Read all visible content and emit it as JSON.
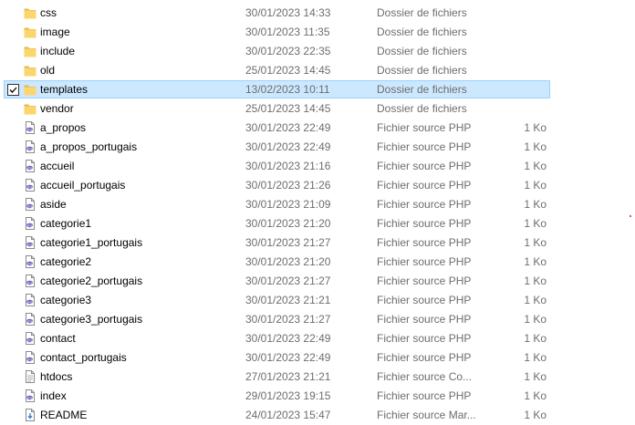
{
  "files": [
    {
      "name": "css",
      "date": "30/01/2023 14:33",
      "type": "Dossier de fichiers",
      "size": "",
      "icon": "folder-icon"
    },
    {
      "name": "image",
      "date": "30/01/2023 11:35",
      "type": "Dossier de fichiers",
      "size": "",
      "icon": "folder-icon"
    },
    {
      "name": "include",
      "date": "30/01/2023 22:35",
      "type": "Dossier de fichiers",
      "size": "",
      "icon": "folder-icon"
    },
    {
      "name": "old",
      "date": "25/01/2023 14:45",
      "type": "Dossier de fichiers",
      "size": "",
      "icon": "folder-icon"
    },
    {
      "name": "templates",
      "date": "13/02/2023 10:11",
      "type": "Dossier de fichiers",
      "size": "",
      "icon": "folder-icon",
      "selected": true,
      "checked": true
    },
    {
      "name": "vendor",
      "date": "25/01/2023 14:45",
      "type": "Dossier de fichiers",
      "size": "",
      "icon": "folder-icon"
    },
    {
      "name": "a_propos",
      "date": "30/01/2023 22:49",
      "type": "Fichier source PHP",
      "size": "1 Ko",
      "icon": "php-file-icon"
    },
    {
      "name": "a_propos_portugais",
      "date": "30/01/2023 22:49",
      "type": "Fichier source PHP",
      "size": "1 Ko",
      "icon": "php-file-icon"
    },
    {
      "name": "accueil",
      "date": "30/01/2023 21:16",
      "type": "Fichier source PHP",
      "size": "1 Ko",
      "icon": "php-file-icon"
    },
    {
      "name": "accueil_portugais",
      "date": "30/01/2023 21:26",
      "type": "Fichier source PHP",
      "size": "1 Ko",
      "icon": "php-file-icon"
    },
    {
      "name": "aside",
      "date": "30/01/2023 21:09",
      "type": "Fichier source PHP",
      "size": "1 Ko",
      "icon": "php-file-icon"
    },
    {
      "name": "categorie1",
      "date": "30/01/2023 21:20",
      "type": "Fichier source PHP",
      "size": "1 Ko",
      "icon": "php-file-icon"
    },
    {
      "name": "categorie1_portugais",
      "date": "30/01/2023 21:27",
      "type": "Fichier source PHP",
      "size": "1 Ko",
      "icon": "php-file-icon"
    },
    {
      "name": "categorie2",
      "date": "30/01/2023 21:20",
      "type": "Fichier source PHP",
      "size": "1 Ko",
      "icon": "php-file-icon"
    },
    {
      "name": "categorie2_portugais",
      "date": "30/01/2023 21:27",
      "type": "Fichier source PHP",
      "size": "1 Ko",
      "icon": "php-file-icon"
    },
    {
      "name": "categorie3",
      "date": "30/01/2023 21:21",
      "type": "Fichier source PHP",
      "size": "1 Ko",
      "icon": "php-file-icon"
    },
    {
      "name": "categorie3_portugais",
      "date": "30/01/2023 21:27",
      "type": "Fichier source PHP",
      "size": "1 Ko",
      "icon": "php-file-icon"
    },
    {
      "name": "contact",
      "date": "30/01/2023 22:49",
      "type": "Fichier source PHP",
      "size": "1 Ko",
      "icon": "php-file-icon"
    },
    {
      "name": "contact_portugais",
      "date": "30/01/2023 22:49",
      "type": "Fichier source PHP",
      "size": "1 Ko",
      "icon": "php-file-icon"
    },
    {
      "name": "htdocs",
      "date": "27/01/2023 21:21",
      "type": "Fichier source Co...",
      "size": "1 Ko",
      "icon": "text-file-icon"
    },
    {
      "name": "index",
      "date": "29/01/2023 19:15",
      "type": "Fichier source PHP",
      "size": "1 Ko",
      "icon": "php-file-icon"
    },
    {
      "name": "README",
      "date": "24/01/2023 15:47",
      "type": "Fichier source Mar...",
      "size": "1 Ko",
      "icon": "markdown-file-icon"
    }
  ],
  "colors": {
    "selection_bg": "#cce8ff",
    "selection_border": "#99d1ff",
    "folder": "#f8d775",
    "php": "#8892bf"
  }
}
